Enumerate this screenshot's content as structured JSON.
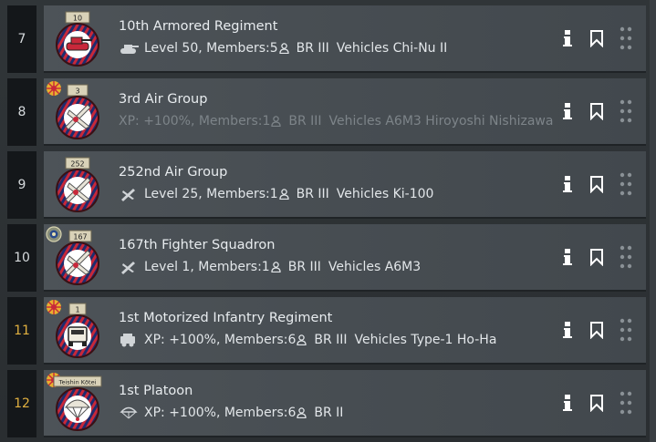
{
  "rows": [
    {
      "rank": "7",
      "rank_color": "white",
      "emblem": "tank-emblem",
      "emblem_label": "10",
      "has_flag": false,
      "name": "10th Armored Regiment",
      "type_icon": "tank-icon",
      "dim": false,
      "stat_main": "Level 50, Members:5",
      "br": "BR III",
      "vehicles": "Vehicles Chi-Nu II"
    },
    {
      "rank": "8",
      "rank_color": "white",
      "emblem": "plane-emblem",
      "emblem_label": "3",
      "has_flag": true,
      "name": "3rd Air Group",
      "type_icon": "",
      "dim": true,
      "stat_main": "XP: +100%, Members:1",
      "br": "BR III",
      "vehicles": "Vehicles A6M3 Hiroyoshi Nishizawa"
    },
    {
      "rank": "9",
      "rank_color": "white",
      "emblem": "plane-emblem",
      "emblem_label": "252",
      "has_flag": false,
      "name": "252nd Air Group",
      "type_icon": "plane-icon",
      "dim": false,
      "stat_main": "Level 25, Members:1",
      "br": "BR III",
      "vehicles": "Vehicles Ki-100"
    },
    {
      "rank": "10",
      "rank_color": "white",
      "emblem": "plane-emblem",
      "emblem_label": "167",
      "has_flag": false,
      "has_medal": true,
      "name": "167th Fighter Squadron",
      "type_icon": "plane-icon",
      "dim": false,
      "stat_main": "Level 1, Members:1",
      "br": "BR III",
      "vehicles": "Vehicles A6M3"
    },
    {
      "rank": "11",
      "rank_color": "gold",
      "emblem": "truck-emblem",
      "emblem_label": "1",
      "has_flag": true,
      "name": "1st Motorized Infantry Regiment",
      "type_icon": "truck-icon",
      "dim": false,
      "stat_main": "XP: +100%, Members:6",
      "br": "BR III",
      "vehicles": "Vehicles Type-1 Ho-Ha"
    },
    {
      "rank": "12",
      "rank_color": "gold",
      "emblem": "parachute-emblem",
      "emblem_label": "Teishin Kōtei",
      "has_flag": true,
      "name": "1st Platoon",
      "type_icon": "parachute-icon",
      "dim": false,
      "stat_main": "XP: +100%, Members:6",
      "br": "BR II",
      "vehicles": ""
    }
  ],
  "colors": {
    "accent_gold": "#e0b040",
    "emblem_red": "#c8283a",
    "emblem_navy": "#1e2c6e"
  }
}
